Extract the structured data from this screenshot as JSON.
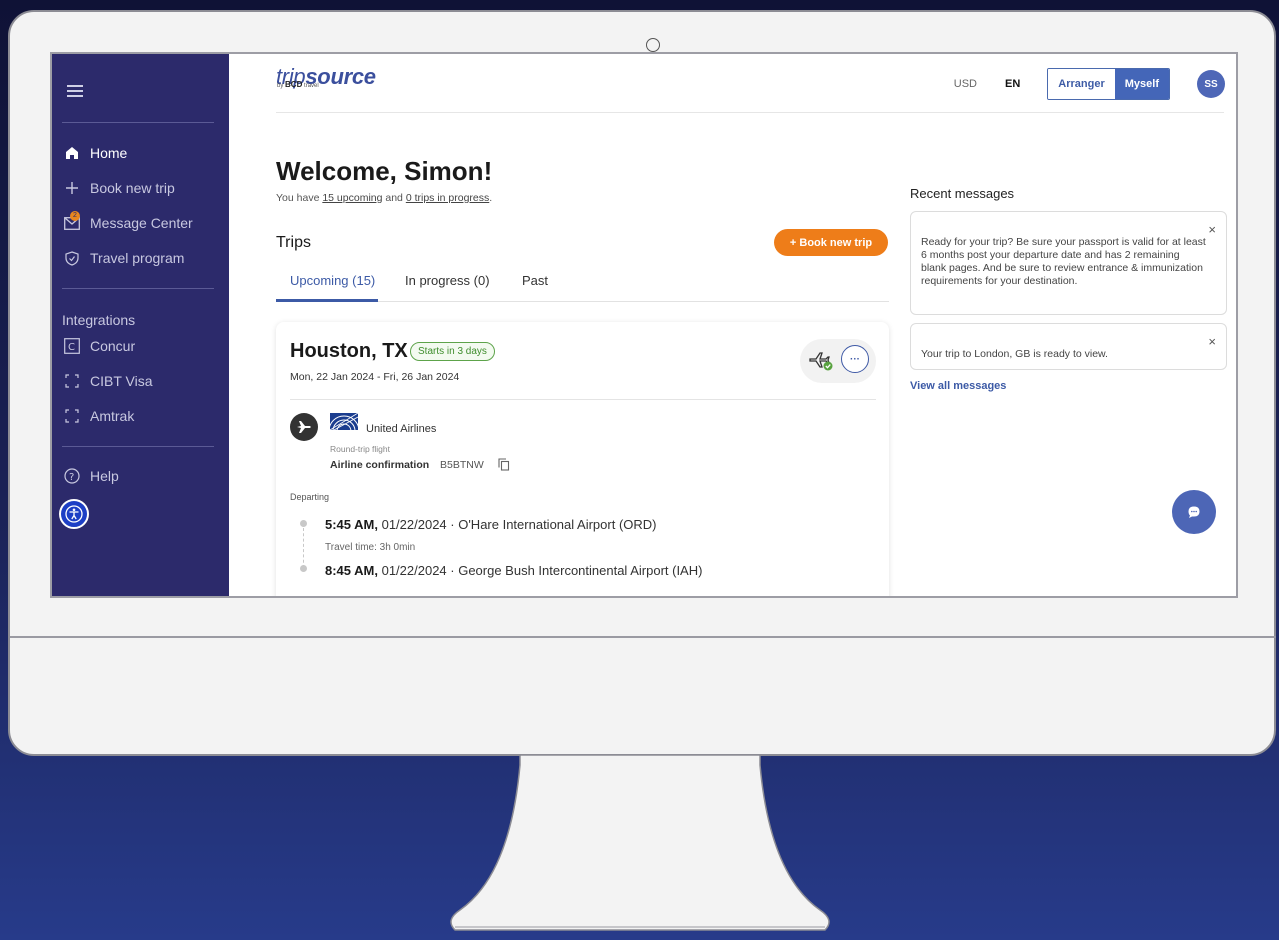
{
  "sidebar": {
    "items": [
      {
        "label": "Home",
        "icon": "home-icon"
      },
      {
        "label": "Book new trip",
        "icon": "plus-icon"
      },
      {
        "label": "Message Center",
        "icon": "mail-icon",
        "badge": "2"
      },
      {
        "label": "Travel program",
        "icon": "shield-icon"
      }
    ],
    "integrations_label": "Integrations",
    "integrations": [
      {
        "label": "Concur",
        "icon": "concur-icon"
      },
      {
        "label": "CIBT Visa",
        "icon": "frame-icon"
      },
      {
        "label": "Amtrak",
        "icon": "frame-icon"
      }
    ],
    "help_label": "Help"
  },
  "header": {
    "logo_prefix": "trip",
    "logo_bold": "source",
    "logo_by": "by",
    "logo_brand": "BCD",
    "logo_brand_suffix": "travel",
    "currency": "USD",
    "language": "EN",
    "arranger_label": "Arranger",
    "myself_label": "Myself",
    "avatar_initials": "SS"
  },
  "welcome": {
    "title": "Welcome, Simon!",
    "prefix": "You have ",
    "upcoming_link": "15 upcoming",
    "middle": " and ",
    "progress_link": "0 trips in progress",
    "suffix": "."
  },
  "trips": {
    "heading": "Trips",
    "book_button": "+  Book new trip",
    "tabs": [
      "Upcoming (15)",
      "In progress (0)",
      "Past"
    ]
  },
  "trip_card": {
    "city": "Houston, TX",
    "status": "Starts in 3 days",
    "dates": "Mon, 22 Jan 2024 - Fri, 26 Jan 2024",
    "more_label": "···",
    "airline": "United Airlines",
    "flight_type": "Round-trip flight",
    "confirmation_label": "Airline confirmation",
    "confirmation_code": "B5BTNW",
    "departing_label": "Departing",
    "legs": [
      {
        "time": "5:45 AM,",
        "rest": " 01/22/2024 · O'Hare International Airport (ORD)"
      },
      {
        "time": "8:45 AM,",
        "rest": " 01/22/2024 · George Bush Intercontinental Airport (IAH)"
      }
    ],
    "travel_time": "Travel time: 3h 0min"
  },
  "messages": {
    "title": "Recent messages",
    "items": [
      {
        "text": "Ready for your trip? Be sure your passport is valid for at least 6 months post your departure date and has 2 remaining blank pages. And be sure to review entrance & immunization requirements for your destination."
      },
      {
        "text": "Your trip to London, GB is ready to view."
      }
    ],
    "close_label": "×",
    "view_all": "View all messages"
  },
  "colors": {
    "sidebar": "#2c2a6b",
    "accent": "#3c5aa6",
    "orange": "#ee7d19",
    "green": "#5da34a"
  }
}
